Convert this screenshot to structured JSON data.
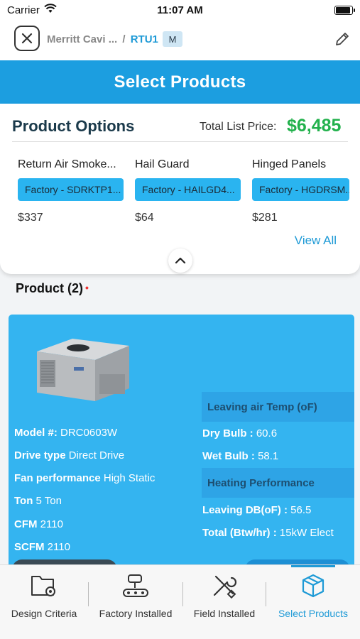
{
  "status_bar": {
    "carrier": "Carrier",
    "time": "11:07 AM"
  },
  "nav": {
    "breadcrumb_parent": "Merritt Cavi ...",
    "separator": "/",
    "breadcrumb_current": "RTU1",
    "badge": "M"
  },
  "header": {
    "title": "Select Products"
  },
  "product_options": {
    "title": "Product Options",
    "total_label": "Total List Price:",
    "total_value": "$6,485",
    "items": [
      {
        "name": "Return Air Smoke...",
        "chip": "Factory - SDRKTP1...",
        "price": "$337"
      },
      {
        "name": "Hail Guard",
        "chip": "Factory - HAILGD4...",
        "price": "$64"
      },
      {
        "name": "Hinged Panels",
        "chip": "Factory - HGDRSM...",
        "price": "$281"
      }
    ],
    "view_all": "View All"
  },
  "product": {
    "heading": "Product (2)",
    "required_mark": "•",
    "specs": [
      {
        "label": "Model #:",
        "value": "DRC0603W"
      },
      {
        "label": "Drive type",
        "value": "Direct Drive"
      },
      {
        "label": "Fan performance",
        "value": "High Static"
      },
      {
        "label": "Ton",
        "value": "5 Ton"
      },
      {
        "label": "CFM",
        "value": "2110"
      },
      {
        "label": "SCFM",
        "value": "2110"
      }
    ],
    "leaving_air_title": "Leaving air Temp (oF)",
    "dry_bulb": {
      "label": "Dry Bulb :",
      "value": "60.6"
    },
    "wet_bulb": {
      "label": "Wet Bulb :",
      "value": "58.1"
    },
    "heating_title": "Heating Performance",
    "leaving_db": {
      "label": "Leaving DB(oF) :",
      "value": "56.5"
    },
    "total_btw": {
      "label": "Total (Btw/hr) :",
      "value": "15kW Elect"
    }
  },
  "tabs": [
    {
      "label": "Design Criteria",
      "icon": "folder-gear-icon"
    },
    {
      "label": "Factory Installed",
      "icon": "conveyor-robot-icon"
    },
    {
      "label": "Field Installed",
      "icon": "tools-icon"
    },
    {
      "label": "Select Products",
      "icon": "box-icon",
      "active": true
    }
  ],
  "colors": {
    "primary": "#1c9ee0",
    "card": "#34b4f0",
    "price_green": "#22b14c",
    "link": "#1e9ad6"
  }
}
